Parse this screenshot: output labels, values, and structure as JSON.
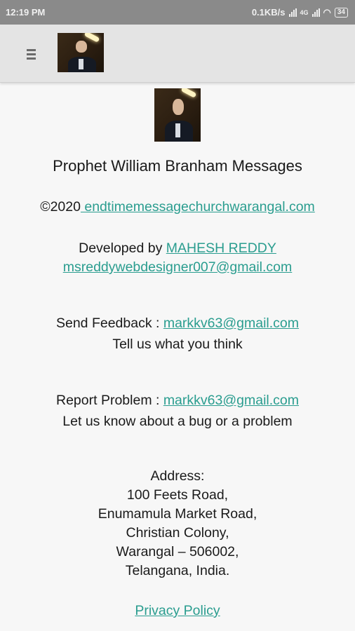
{
  "status_bar": {
    "time": "12:19 PM",
    "speed": "0.1KB/s",
    "network_1": "4G",
    "network_2": "4G",
    "battery": "34"
  },
  "app_bar": {
    "menu_icon": "hamburger-menu-icon",
    "avatar": "portrait-thumbnail"
  },
  "content": {
    "title": "Prophet William Branham Messages",
    "copyright_prefix": "©2020",
    "website_link": " endtimemessagechurchwarangal.com",
    "developed_by_label": "Developed by ",
    "developer_name": "MAHESH REDDY ",
    "developer_email": " msreddywebdesigner007@gmail.com",
    "feedback_label": "Send Feedback : ",
    "feedback_email": "markkv63@gmail.com",
    "feedback_note": "Tell us what you think",
    "report_label": "Report Problem : ",
    "report_email": "markkv63@gmail.com",
    "report_note": "Let us know about a bug or a problem",
    "address_label": "Address:",
    "address_lines": [
      "100 Feets Road,",
      "Enumamula Market Road,",
      "Christian Colony,",
      "Warangal – 506002,",
      "Telangana, India."
    ],
    "privacy_link": "Privacy Policy"
  }
}
